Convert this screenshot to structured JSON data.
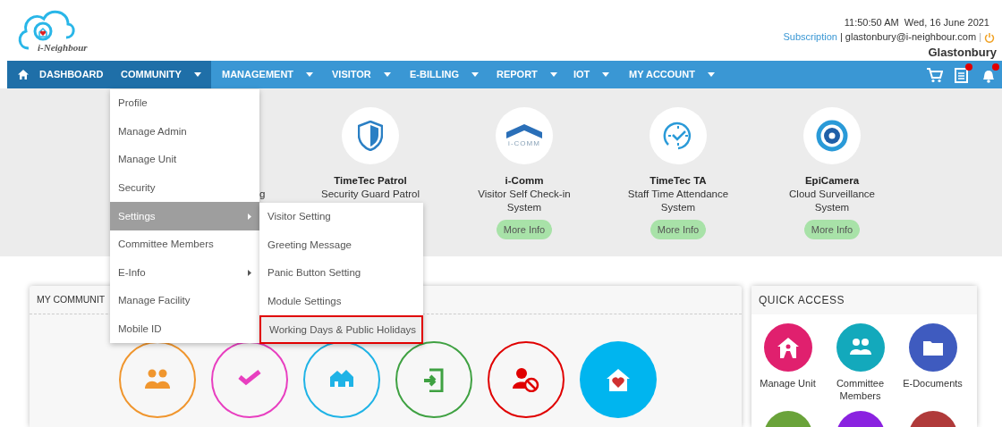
{
  "logo": {
    "text": "i-Neighbour"
  },
  "header": {
    "datetime": "11:50:50 AM  Wed, 16 June 2021",
    "subscription": "Subscription",
    "separator": "|",
    "email": "glastonbury@i-neighbour.com",
    "separator_2": "|",
    "community_name": "Glastonbury"
  },
  "nav": [
    {
      "label": "DASHBOARD",
      "kind": "home",
      "highlighted": true
    },
    {
      "label": "COMMUNITY",
      "kind": "dropdown",
      "highlighted": true
    },
    {
      "label": "MANAGEMENT",
      "kind": "dropdown",
      "highlighted": false
    },
    {
      "label": "VISITOR",
      "kind": "dropdown",
      "highlighted": false
    },
    {
      "label": "E-BILLING",
      "kind": "dropdown",
      "highlighted": false
    },
    {
      "label": "REPORT",
      "kind": "dropdown",
      "highlighted": false
    },
    {
      "label": "IOT",
      "kind": "dropdown",
      "highlighted": false
    },
    {
      "label": "MY ACCOUNT",
      "kind": "dropdown",
      "highlighted": false
    }
  ],
  "nav_icons": [
    {
      "kind": "cart",
      "badge": false
    },
    {
      "kind": "document",
      "badge": true
    },
    {
      "kind": "bell",
      "badge": true
    }
  ],
  "apps": [
    {
      "kind": "partial",
      "description": [
        "g"
      ]
    },
    {
      "kind": "patrol",
      "title": "TimeTec Patrol",
      "description": [
        "Security Guard Patrol"
      ]
    },
    {
      "kind": "icomm",
      "logo_text": "i-COMM",
      "title": "i-Comm",
      "description": [
        "Visitor Self Check-in",
        "System"
      ],
      "button": "More Info"
    },
    {
      "kind": "clock",
      "title": "TimeTec TA",
      "description": [
        "Staff Time Attendance",
        "System"
      ],
      "button": "More Info"
    },
    {
      "kind": "camera",
      "title": "EpiCamera",
      "description": [
        "Cloud Surveillance",
        "System"
      ],
      "button": "More Info"
    }
  ],
  "community_card": {
    "title": "MY COMMUNIT",
    "tiles": [
      {
        "kind": "members",
        "color": "#f0962e",
        "filled": false
      },
      {
        "kind": "check",
        "color": "#e83fc0",
        "filled": false
      },
      {
        "kind": "houses",
        "color": "#1fb3e6",
        "filled": false
      },
      {
        "kind": "login",
        "color": "#3fa142",
        "filled": false
      },
      {
        "kind": "blocked",
        "color": "#e00000",
        "filled": false
      },
      {
        "kind": "heart-house",
        "color": "#00b5ef",
        "filled": true
      }
    ]
  },
  "quick_access": {
    "title": "QUICK ACCESS",
    "items": [
      {
        "kind": "unit",
        "color": "#e0206e",
        "label": [
          "Manage Unit"
        ]
      },
      {
        "kind": "members",
        "color": "#13a9bc",
        "label": [
          "Committee",
          "Members"
        ]
      },
      {
        "kind": "folder",
        "color": "#3f5bbf",
        "label": [
          "E-Documents"
        ]
      },
      {
        "kind": "blank",
        "color": "#6aa33a"
      },
      {
        "kind": "blank",
        "color": "#8a22e0"
      },
      {
        "kind": "blank",
        "color": "#b03a3a"
      }
    ]
  },
  "menu": {
    "items": [
      {
        "label": "Profile",
        "submenu": false,
        "selected": false
      },
      {
        "label": "Manage Admin",
        "submenu": false,
        "selected": false
      },
      {
        "label": "Manage Unit",
        "submenu": false,
        "selected": false
      },
      {
        "label": "Security",
        "submenu": false,
        "selected": false
      },
      {
        "label": "Settings",
        "submenu": true,
        "selected": true
      },
      {
        "label": "Committee Members",
        "submenu": false,
        "selected": false
      },
      {
        "label": "E-Info",
        "submenu": true,
        "selected": false
      },
      {
        "label": "Manage Facility",
        "submenu": false,
        "selected": false
      },
      {
        "label": "Mobile ID",
        "submenu": false,
        "selected": false
      }
    ]
  },
  "submenu": {
    "items": [
      {
        "label": "Visitor Setting",
        "selected": false
      },
      {
        "label": "Greeting Message",
        "selected": false
      },
      {
        "label": "Panic Button Setting",
        "selected": false
      },
      {
        "label": "Module Settings",
        "selected": false
      },
      {
        "label": "Working Days & Public Holidays",
        "selected": true
      }
    ]
  }
}
